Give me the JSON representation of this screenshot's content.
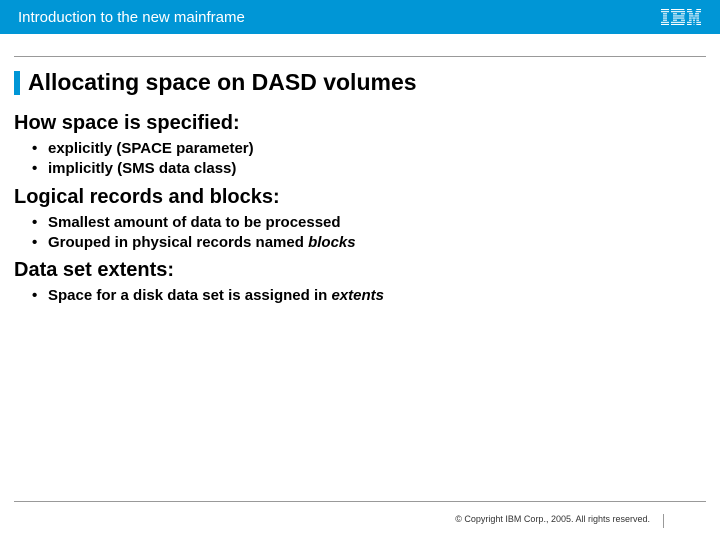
{
  "header": {
    "title": "Introduction to the new mainframe",
    "logo": "IBM"
  },
  "slide": {
    "title": "Allocating space on DASD volumes",
    "sections": [
      {
        "heading": "How space is specified:",
        "bullets": [
          {
            "text": "explicitly (SPACE parameter)"
          },
          {
            "text": "implicitly (SMS data class)"
          }
        ]
      },
      {
        "heading": "Logical records and blocks:",
        "bullets": [
          {
            "text": "Smallest amount of data to be processed"
          },
          {
            "text_pre": "Grouped in physical records named ",
            "text_em": "blocks"
          }
        ]
      },
      {
        "heading": "Data set extents:",
        "bullets": [
          {
            "text_pre": "Space for a disk data set is assigned in ",
            "text_em": "extents"
          }
        ]
      }
    ]
  },
  "footer": {
    "copyright": "© Copyright IBM Corp., 2005. All rights reserved."
  }
}
